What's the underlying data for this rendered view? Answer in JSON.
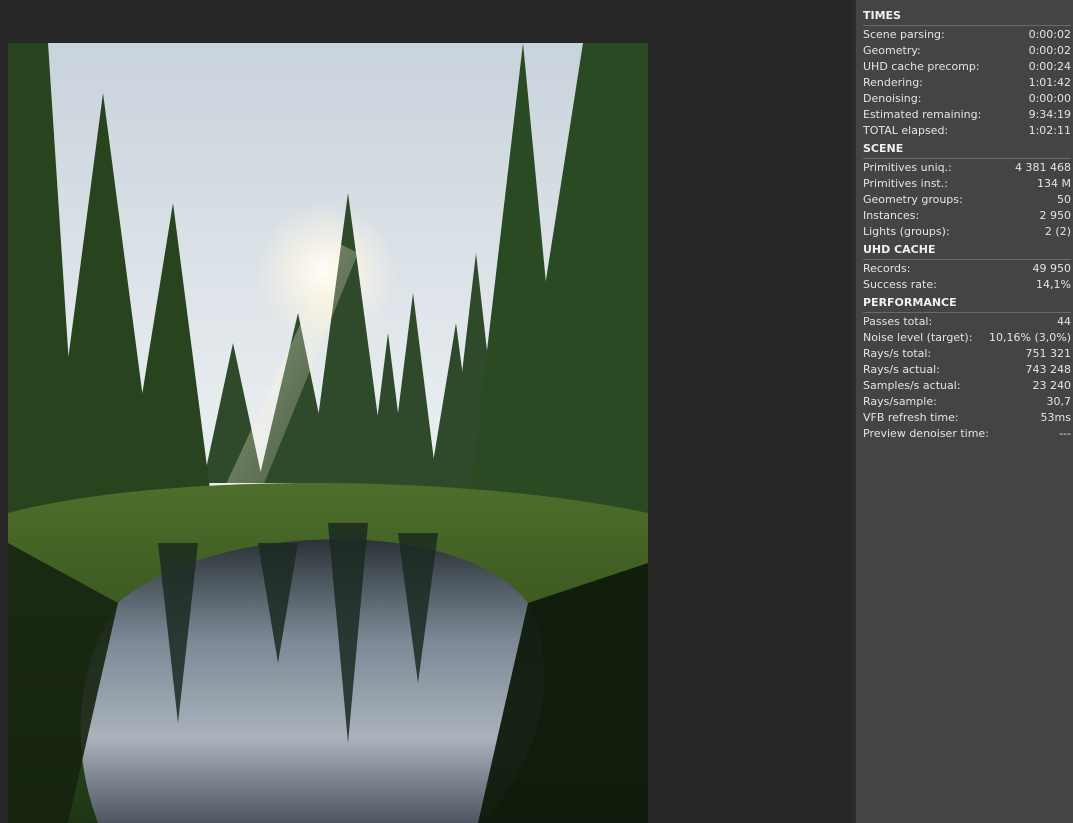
{
  "stats": {
    "times": {
      "title": "TIMES",
      "rows": [
        {
          "label": "Scene parsing:",
          "value": "0:00:02"
        },
        {
          "label": "Geometry:",
          "value": "0:00:02"
        },
        {
          "label": "UHD cache precomp:",
          "value": "0:00:24"
        },
        {
          "label": "Rendering:",
          "value": "1:01:42"
        },
        {
          "label": "Denoising:",
          "value": "0:00:00"
        },
        {
          "label": "Estimated remaining:",
          "value": "9:34:19"
        },
        {
          "label": "TOTAL elapsed:",
          "value": "1:02:11"
        }
      ]
    },
    "scene": {
      "title": "SCENE",
      "rows": [
        {
          "label": "Primitives uniq.:",
          "value": "4 381 468"
        },
        {
          "label": "Primitives inst.:",
          "value": "134 M"
        },
        {
          "label": "Geometry groups:",
          "value": "50"
        },
        {
          "label": "Instances:",
          "value": "2 950"
        },
        {
          "label": "Lights (groups):",
          "value": "2 (2)"
        }
      ]
    },
    "uhd_cache": {
      "title": "UHD CACHE",
      "rows": [
        {
          "label": "Records:",
          "value": "49 950"
        },
        {
          "label": "Success rate:",
          "value": "14,1%"
        }
      ]
    },
    "performance": {
      "title": "PERFORMANCE",
      "rows": [
        {
          "label": "Passes total:",
          "value": "44"
        },
        {
          "label": "Noise level (target):",
          "value": "10,16% (3,0%)"
        },
        {
          "label": "Rays/s total:",
          "value": "751 321"
        },
        {
          "label": "Rays/s actual:",
          "value": "743 248"
        },
        {
          "label": "Samples/s actual:",
          "value": "23 240"
        },
        {
          "label": "Rays/sample:",
          "value": "30,7"
        },
        {
          "label": "VFB refresh time:",
          "value": "53ms"
        },
        {
          "label": "Preview denoiser time:",
          "value": "---"
        }
      ]
    }
  }
}
